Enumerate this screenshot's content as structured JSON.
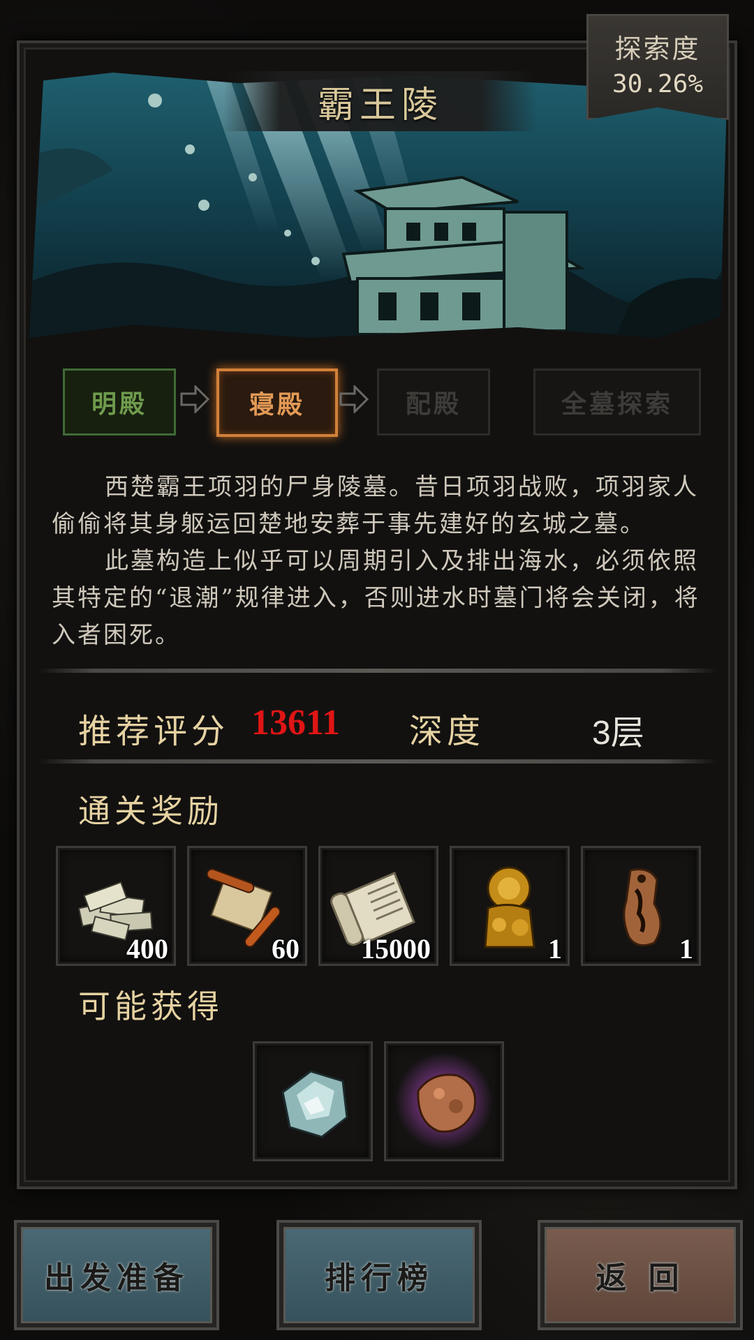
{
  "dungeon": {
    "title": "霸王陵",
    "explore_label": "探索度",
    "explore_value": "30.26%"
  },
  "stages": [
    {
      "label": "明殿",
      "state": "cleared"
    },
    {
      "label": "寝殿",
      "state": "selected"
    },
    {
      "label": "配殿",
      "state": "locked"
    },
    {
      "label": "全墓探索",
      "state": "locked"
    }
  ],
  "description": {
    "paragraph1": "西楚霸王项羽的尸身陵墓。昔日项羽战败，项羽家人偷偷将其身躯运回楚地安葬于事先建好的玄城之墓。",
    "paragraph2": "此墓构造上似乎可以周期引入及排出海水，必须依照其特定的“退潮”规律进入，否则进水时墓门将会关闭，将入者困死。"
  },
  "stats": {
    "score_label": "推荐评分",
    "score_value": "13611",
    "depth_label": "深度",
    "depth_value": "3层"
  },
  "rewards": {
    "title": "通关奖励",
    "items": [
      {
        "icon": "money-stack-icon",
        "count": "400"
      },
      {
        "icon": "scroll-icon",
        "count": "60"
      },
      {
        "icon": "book-scroll-icon",
        "count": "15000"
      },
      {
        "icon": "gold-lion-statue-icon",
        "count": "1"
      },
      {
        "icon": "bronze-token-icon",
        "count": "1"
      }
    ]
  },
  "possible": {
    "title": "可能获得",
    "items": [
      {
        "icon": "crystal-ore-icon"
      },
      {
        "icon": "copper-ore-icon"
      }
    ]
  },
  "buttons": {
    "depart": "出发准备",
    "ranking": "排行榜",
    "back": "返 回"
  },
  "colors": {
    "score": "#e01515",
    "label_gold": "#e6d2a2",
    "selected_stage": "#d1813a",
    "cleared_stage": "#3f6b35"
  }
}
